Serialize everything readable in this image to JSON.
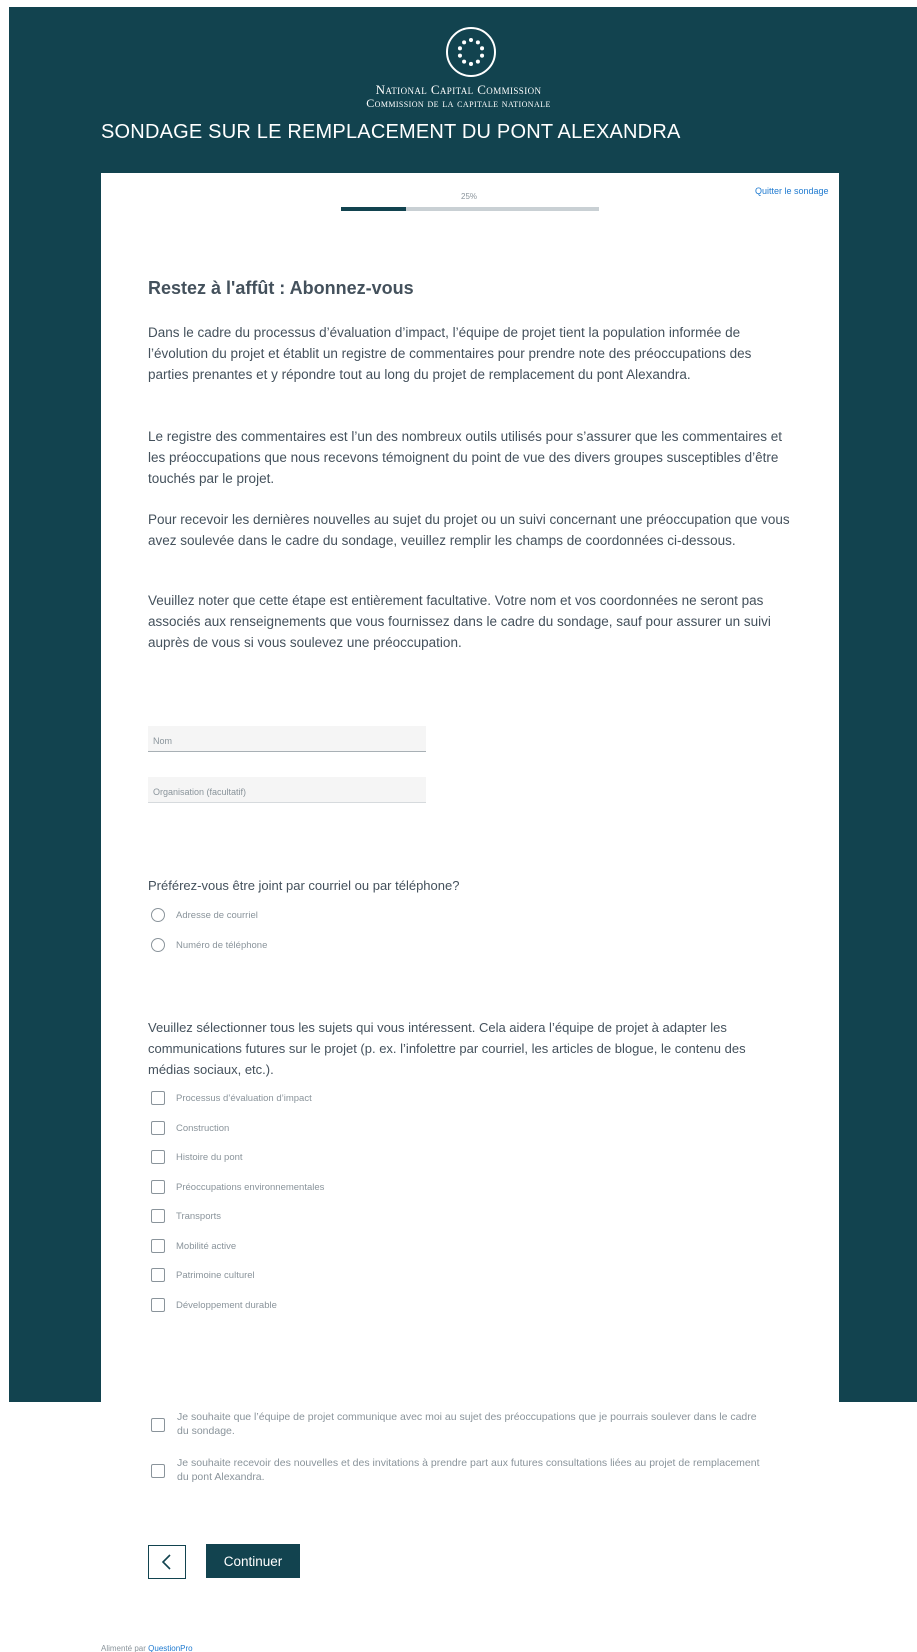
{
  "header": {
    "org_name_en": "National Capital Commission",
    "org_name_fr": "Commission de la capitale nationale",
    "survey_title": "SONDAGE SUR LE REMPLACEMENT DU PONT ALEXANDRA"
  },
  "progress": {
    "label": "25%",
    "value": 0.25
  },
  "quit_link": "Quitter le sondage",
  "page": {
    "heading": "Restez à l'affût : Abonnez-vous",
    "paragraphs": [
      "Dans le cadre du processus d’évaluation d’impact, l’équipe de projet tient la population informée de l’évolution du projet et établit un registre de commentaires pour prendre note des préoccupations des parties prenantes et y répondre tout au long du projet de remplacement du pont Alexandra.",
      "Le registre des commentaires est l’un des nombreux outils utilisés pour s’assurer que les commentaires et les préoccupations que nous recevons témoignent du point de vue des divers groupes susceptibles d’être touchés par le projet.",
      "Pour recevoir les dernières nouvelles au sujet du projet ou un suivi concernant une préoccupation que vous avez soulevée dans le cadre du sondage, veuillez remplir les champs de coordonnées ci-dessous.",
      "Veuillez noter que cette étape est entièrement facultative. Votre nom et vos coordonnées ne seront pas associés aux renseignements que vous fournissez dans le cadre du sondage, sauf pour assurer un suivi auprès de vous si vous soulevez une préoccupation."
    ]
  },
  "fields": {
    "name_placeholder": "Nom",
    "name_value": "",
    "org_placeholder": "Organisation (facultatif)",
    "org_value": ""
  },
  "contact_question": {
    "label": "Préférez-vous être joint par courriel ou par téléphone?",
    "options": [
      "Adresse de courriel",
      "Numéro de téléphone"
    ]
  },
  "topics_question": {
    "label": "Veuillez sélectionner tous les sujets qui vous intéressent. Cela aidera l’équipe de projet à adapter les communications futures sur le projet (p. ex. l’infolettre par courriel, les articles de blogue, le contenu des médias sociaux, etc.).",
    "options": [
      "Processus d’évaluation d’impact",
      "Construction",
      "Histoire du pont",
      "Préoccupations environnementales",
      "Transports",
      "Mobilité active",
      "Patrimoine culturel",
      "Développement durable"
    ]
  },
  "consents": [
    "Je souhaite que l’équipe de projet communique avec moi au sujet des préoccupations que je pourrais soulever dans le cadre du sondage.",
    "Je souhaite recevoir des nouvelles et des invitations à prendre part aux futures consultations liées au projet de remplacement du pont Alexandra."
  ],
  "nav": {
    "continue_label": "Continuer"
  },
  "footer": {
    "powered_by": "Alimenté par",
    "brand": "QuestionPro"
  },
  "colors": {
    "brand_teal": "#12434f",
    "link_blue": "#1f7ad0"
  }
}
